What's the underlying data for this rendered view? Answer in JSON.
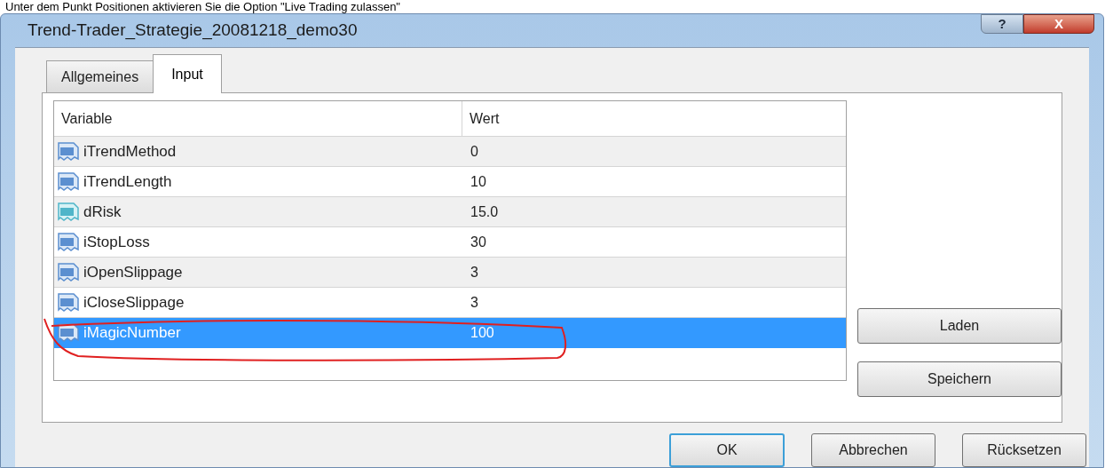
{
  "page_text": "Unter dem Punkt Positionen aktivieren Sie die Option \"Live Trading zulassen\"",
  "window": {
    "title": "Trend-Trader_Strategie_20081218_demo30",
    "title_buttons": [
      "?",
      "X"
    ]
  },
  "tabs": [
    {
      "label": "Allgemeines",
      "selected": false
    },
    {
      "label": "Input",
      "selected": true
    }
  ],
  "table": {
    "columns": [
      "Variable",
      "Wert"
    ],
    "rows": [
      {
        "kind": "int",
        "variable": "iTrendMethod",
        "value": "0",
        "selected": false
      },
      {
        "kind": "int",
        "variable": "iTrendLength",
        "value": "10",
        "selected": false
      },
      {
        "kind": "double",
        "variable": "dRisk",
        "value": "15.0",
        "selected": false
      },
      {
        "kind": "int",
        "variable": "iStopLoss",
        "value": "30",
        "selected": false
      },
      {
        "kind": "int",
        "variable": "iOpenSlippage",
        "value": "3",
        "selected": false
      },
      {
        "kind": "int",
        "variable": "iCloseSlippage",
        "value": "3",
        "selected": false
      },
      {
        "kind": "int",
        "variable": "iMagicNumber",
        "value": "100",
        "selected": true
      }
    ]
  },
  "side_buttons": [
    "Laden",
    "Speichern"
  ],
  "buttons": [
    {
      "label": "OK",
      "default": true
    },
    {
      "label": "Abbrechen",
      "default": false
    },
    {
      "label": "Rücksetzen",
      "default": false
    }
  ]
}
